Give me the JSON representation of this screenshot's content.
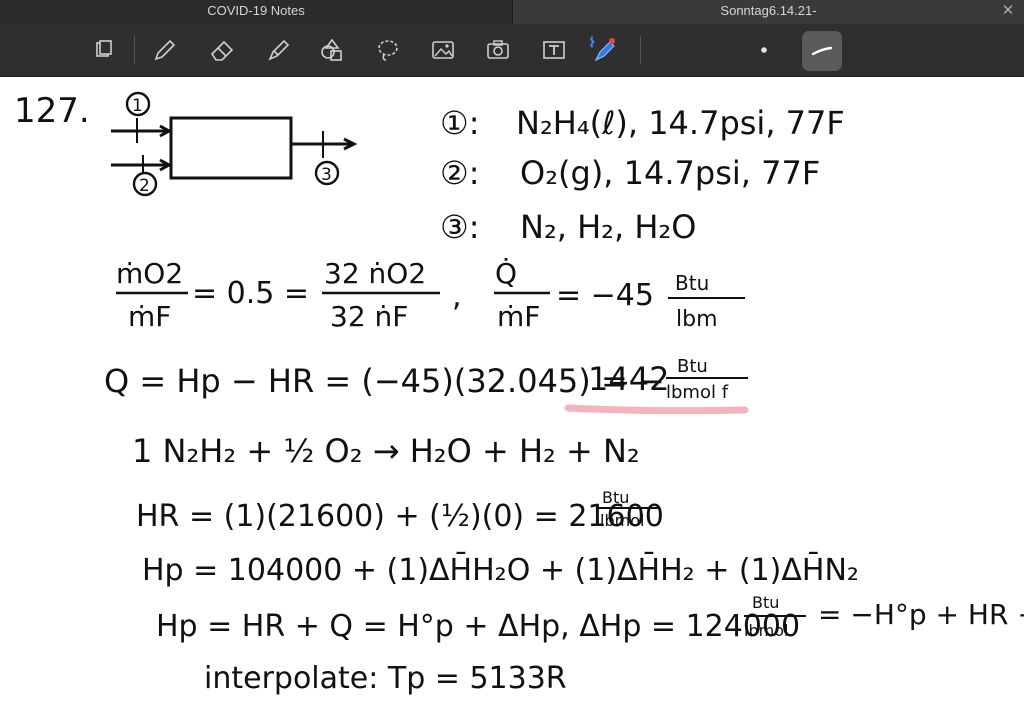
{
  "tabs": [
    {
      "label": "COVID-19 Notes"
    },
    {
      "label": "Sonntag6.14.21-"
    }
  ],
  "toolbar": {
    "icons": [
      "pages-icon",
      "pen-icon",
      "eraser-icon",
      "highlighter-icon",
      "shapes-icon",
      "lasso-icon",
      "image-icon",
      "camera-icon",
      "text-box-icon",
      "bluetooth-pen-icon",
      "dot-size-icon",
      "stroke-style-icon"
    ]
  },
  "notes": {
    "problem_number": "127.",
    "diagram": {
      "inlet_1": "1",
      "inlet_2": "2",
      "outlet_3": "3"
    },
    "streams": [
      {
        "label": "①:",
        "text": "N₂H₄(ℓ), 14.7psi, 77F"
      },
      {
        "label": "②:",
        "text": "O₂(g), 14.7psi, 77F"
      },
      {
        "label": "③:",
        "text": "N₂, H₂, H₂O"
      }
    ],
    "eq_ratio_lhs_num": "ṁO2",
    "eq_ratio_lhs_den": "ṁF",
    "eq_ratio_mid": "= 0.5 =",
    "eq_ratio_rhs_num": "32 ṅO2",
    "eq_ratio_rhs_den": "32 ṅF",
    "eq_q_num": "Q̇",
    "eq_q_den": "ṁF",
    "eq_q_value": "= −45",
    "eq_q_unit_num": "Btu",
    "eq_q_unit_den": "lbm",
    "eq_Q_line": "Q = Hp − HR = (−45)(32.045) = −",
    "eq_Q_value": "1442",
    "eq_Q_unit_num": "Btu",
    "eq_Q_unit_den": "lbmol f",
    "reaction": "1 N₂H₂ + ½ O₂ → H₂O + H₂ + N₂",
    "eq_HR": "HR = (1)(21600) + (½)(0) = 21600",
    "eq_HR_unit_num": "Btu",
    "eq_HR_unit_den": "lbmol",
    "eq_Hp": "Hp = 104000 + (1)ΔH̄H₂O + (1)ΔH̄H₂ + (1)ΔH̄N₂",
    "eq_Hp2": "Hp = HR + Q = H°p + ΔHp,  ΔHp = 124000",
    "eq_Hp2_unit_num": "Btu",
    "eq_Hp2_unit_den": "lbmol",
    "eq_Hp2_tail": "= −H°p + HR + Q",
    "interpolate": "interpolate: Tp = 5133R"
  },
  "colors": {
    "highlight": "#f4a6b2",
    "ink": "#111111",
    "toolbar_bg": "#2f2f31",
    "tabbar_bg": "#2b2b2d"
  }
}
